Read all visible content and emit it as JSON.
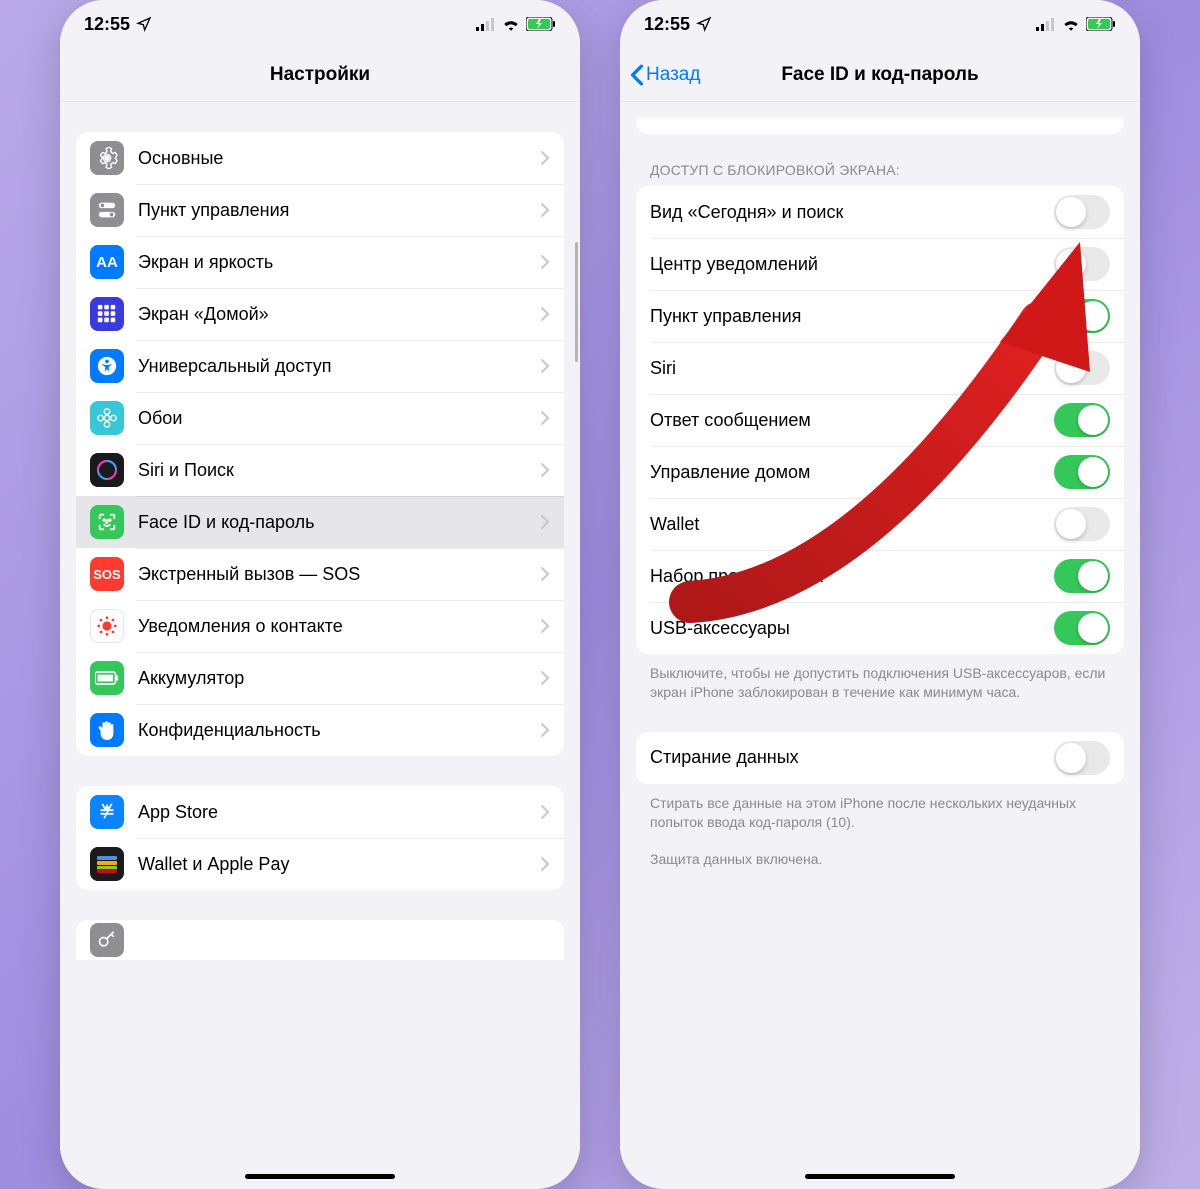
{
  "status": {
    "time": "12:55",
    "location_icon": "location-arrow",
    "signal_icon": "cellular",
    "wifi_icon": "wifi",
    "battery_icon": "battery-charging"
  },
  "left": {
    "title": "Настройки",
    "groups": [
      {
        "items": [
          {
            "label": "Основные",
            "icon": "gear",
            "bg": "#8e8e93"
          },
          {
            "label": "Пункт управления",
            "icon": "switches",
            "bg": "#8e8e93"
          },
          {
            "label": "Экран и яркость",
            "icon": "aa",
            "bg": "#007aff"
          },
          {
            "label": "Экран «Домой»",
            "icon": "grid",
            "bg": "#3a3adf"
          },
          {
            "label": "Универсальный доступ",
            "icon": "accessibility",
            "bg": "#007aff"
          },
          {
            "label": "Обои",
            "icon": "flower",
            "bg": "#38c7d8"
          },
          {
            "label": "Siri и Поиск",
            "icon": "siri",
            "bg": "#1a1a1a"
          },
          {
            "label": "Face ID и код-пароль",
            "icon": "faceid",
            "bg": "#34c759",
            "selected": true
          },
          {
            "label": "Экстренный вызов — SOS",
            "icon": "sos",
            "bg": "#ff3b30"
          },
          {
            "label": "Уведомления о контакте",
            "icon": "exposure",
            "bg": "#ffffff"
          },
          {
            "label": "Аккумулятор",
            "icon": "battery",
            "bg": "#34c759"
          },
          {
            "label": "Конфиденциальность",
            "icon": "hand",
            "bg": "#007aff"
          }
        ]
      },
      {
        "items": [
          {
            "label": "App Store",
            "icon": "appstore",
            "bg": "#0a84ff"
          },
          {
            "label": "Wallet и Apple Pay",
            "icon": "wallet",
            "bg": "#1a1a1a"
          }
        ]
      }
    ],
    "partial_next": {
      "icon": "key",
      "bg": "#8e8e93"
    }
  },
  "right": {
    "back_label": "Назад",
    "title": "Face ID и код-пароль",
    "section_header": "ДОСТУП С БЛОКИРОВКОЙ ЭКРАНА:",
    "toggles": [
      {
        "label": "Вид «Сегодня» и поиск",
        "on": false
      },
      {
        "label": "Центр уведомлений",
        "on": false
      },
      {
        "label": "Пункт управления",
        "on": true
      },
      {
        "label": "Siri",
        "on": false
      },
      {
        "label": "Ответ сообщением",
        "on": true
      },
      {
        "label": "Управление домом",
        "on": true
      },
      {
        "label": "Wallet",
        "on": false
      },
      {
        "label": "Набор пропущенных",
        "on": true
      },
      {
        "label": "USB-аксессуары",
        "on": true
      }
    ],
    "usb_footer": "Выключите, чтобы не допустить подключения USB-аксессуаров, если экран iPhone заблокирован в течение как минимум часа.",
    "erase": {
      "label": "Стирание данных",
      "on": false
    },
    "erase_footer1": "Стирать все данные на этом iPhone после нескольких неудачных попыток ввода код-пароля (10).",
    "erase_footer2": "Защита данных включена."
  }
}
